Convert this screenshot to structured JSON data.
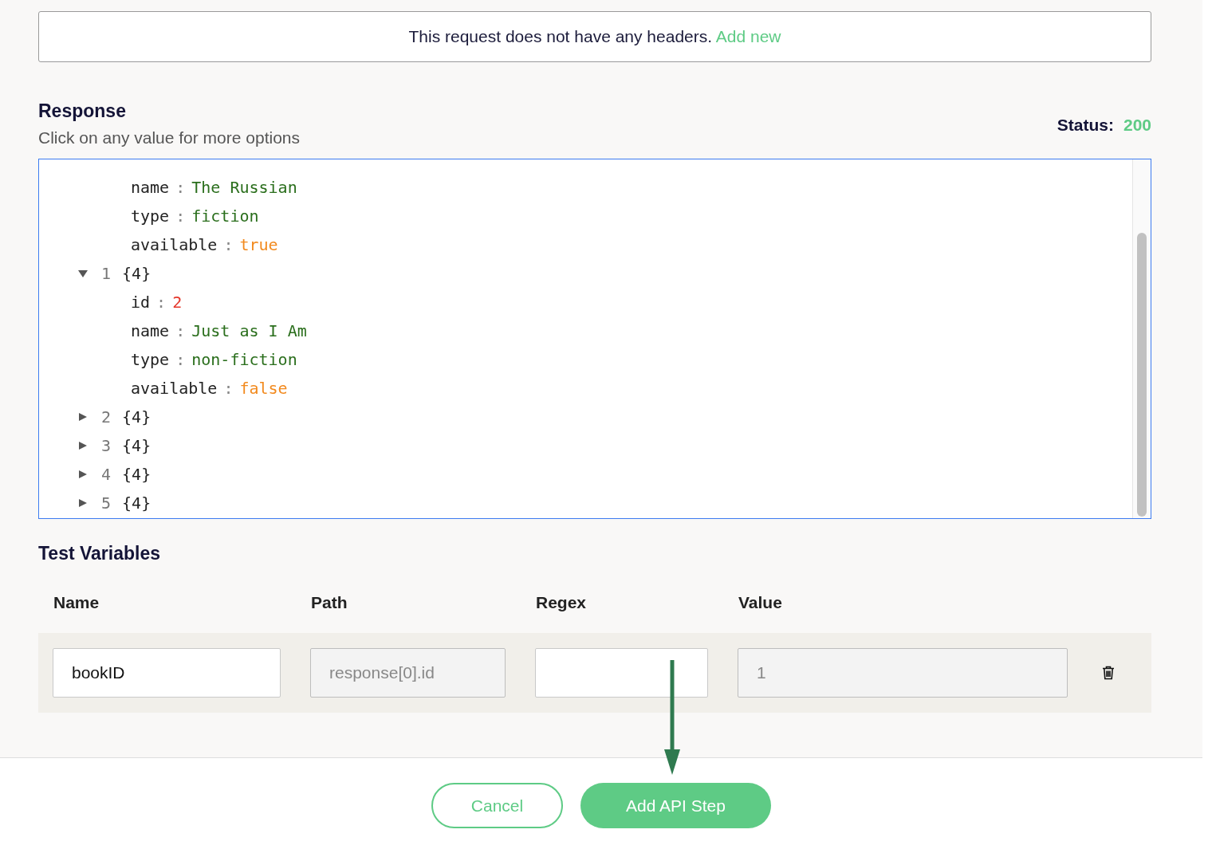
{
  "headers_notice": {
    "text": "This request does not have any headers.",
    "link": "Add new"
  },
  "response": {
    "title": "Response",
    "subtitle": "Click on any value for more options",
    "status_label": "Status:",
    "status": "200",
    "tree": [
      {
        "fields": [
          {
            "key": "name",
            "sep": ":",
            "value": "The Russian",
            "kind": "string"
          },
          {
            "key": "type",
            "sep": ":",
            "value": "fiction",
            "kind": "string"
          },
          {
            "key": "available",
            "sep": ":",
            "value": "true",
            "kind": "boolean"
          }
        ]
      },
      {
        "index": "1",
        "summary": "{4}",
        "expanded": true,
        "fields": [
          {
            "key": "id",
            "sep": ":",
            "value": "2",
            "kind": "number"
          },
          {
            "key": "name",
            "sep": ":",
            "value": "Just as I Am",
            "kind": "string"
          },
          {
            "key": "type",
            "sep": ":",
            "value": "non-fiction",
            "kind": "string"
          },
          {
            "key": "available",
            "sep": ":",
            "value": "false",
            "kind": "boolean"
          }
        ]
      },
      {
        "index": "2",
        "summary": "{4}",
        "expanded": false
      },
      {
        "index": "3",
        "summary": "{4}",
        "expanded": false
      },
      {
        "index": "4",
        "summary": "{4}",
        "expanded": false
      },
      {
        "index": "5",
        "summary": "{4}",
        "expanded": false
      }
    ]
  },
  "test_variables": {
    "title": "Test Variables",
    "columns": [
      "Name",
      "Path",
      "Regex",
      "Value"
    ],
    "row": [
      {
        "value": "bookID",
        "disabled": false
      },
      {
        "value": "response[0].id",
        "disabled": true
      },
      {
        "disabled": false
      },
      {
        "value": "1",
        "disabled": true
      }
    ]
  },
  "buttons": [
    {
      "label": "Cancel",
      "kind": "secondary"
    },
    {
      "label": "Add API Step",
      "kind": "primary"
    }
  ]
}
